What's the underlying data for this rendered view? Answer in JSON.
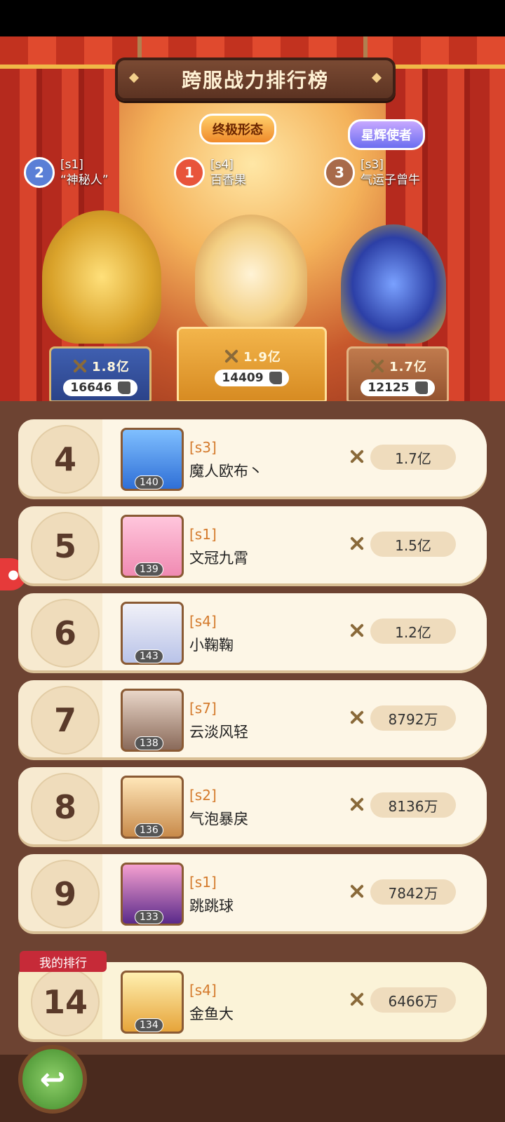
{
  "title": "跨服战力排行榜",
  "tags": {
    "ultimate": "终极形态",
    "star": "星辉使者"
  },
  "podium": [
    {
      "rank": "2",
      "server": "[s1]",
      "name": "“神秘人”",
      "power": "1.8亿",
      "likes": "16646",
      "color": "#5a7fd6"
    },
    {
      "rank": "1",
      "server": "[s4]",
      "name": "百香果",
      "power": "1.9亿",
      "likes": "14409",
      "color": "#e8543b"
    },
    {
      "rank": "3",
      "server": "[s3]",
      "name": "气运子曾牛",
      "power": "1.7亿",
      "likes": "12125",
      "color": "#a86a4a"
    }
  ],
  "list": [
    {
      "rank": "4",
      "server": "[s3]",
      "name": "魔人欧布丶",
      "level": "140",
      "power": "1.7亿"
    },
    {
      "rank": "5",
      "server": "[s1]",
      "name": "文冠九霄",
      "level": "139",
      "power": "1.5亿"
    },
    {
      "rank": "6",
      "server": "[s4]",
      "name": "小鞠鞠",
      "level": "143",
      "power": "1.2亿"
    },
    {
      "rank": "7",
      "server": "[s7]",
      "name": "云淡风轻",
      "level": "138",
      "power": "8792万"
    },
    {
      "rank": "8",
      "server": "[s2]",
      "name": "气泡暴戾",
      "level": "136",
      "power": "8136万"
    },
    {
      "rank": "9",
      "server": "[s1]",
      "name": "跳跳球",
      "level": "133",
      "power": "7842万"
    }
  ],
  "my_rank": {
    "label": "我的排行",
    "rank": "14",
    "server": "[s4]",
    "name": "金鱼大",
    "level": "134",
    "power": "6466万"
  },
  "icons": {
    "back": "back-arrow-icon",
    "like": "thumb-up-icon",
    "power": "crossed-swords-icon"
  }
}
